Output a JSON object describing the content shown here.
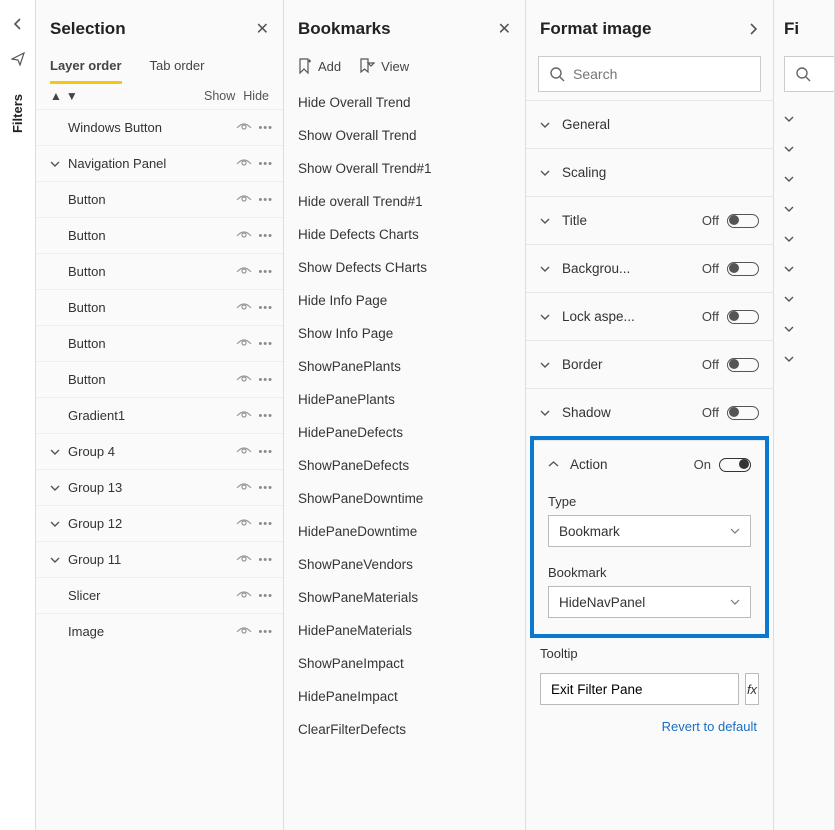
{
  "rail": {
    "filters_label": "Filters"
  },
  "selection": {
    "title": "Selection",
    "tabs": {
      "layer": "Layer order",
      "tab": "Tab order"
    },
    "show_label": "Show",
    "hide_label": "Hide",
    "items": [
      {
        "label": "Windows Button",
        "expandable": false
      },
      {
        "label": "Navigation Panel",
        "expandable": true
      },
      {
        "label": "Button",
        "expandable": false
      },
      {
        "label": "Button",
        "expandable": false
      },
      {
        "label": "Button",
        "expandable": false
      },
      {
        "label": "Button",
        "expandable": false
      },
      {
        "label": "Button",
        "expandable": false
      },
      {
        "label": "Button",
        "expandable": false
      },
      {
        "label": "Gradient1",
        "expandable": false
      },
      {
        "label": "Group 4",
        "expandable": true
      },
      {
        "label": "Group 13",
        "expandable": true
      },
      {
        "label": "Group 12",
        "expandable": true
      },
      {
        "label": "Group 11",
        "expandable": true
      },
      {
        "label": "Slicer",
        "expandable": false
      },
      {
        "label": "Image",
        "expandable": false
      }
    ]
  },
  "bookmarks": {
    "title": "Bookmarks",
    "add_label": "Add",
    "view_label": "View",
    "items": [
      "Hide Overall Trend",
      "Show Overall Trend",
      "Show Overall Trend#1",
      "Hide overall Trend#1",
      "Hide Defects Charts",
      "Show Defects CHarts",
      "Hide Info Page",
      "Show Info Page",
      "ShowPanePlants",
      "HidePanePlants",
      "HidePaneDefects",
      "ShowPaneDefects",
      "ShowPaneDowntime",
      "HidePaneDowntime",
      "ShowPaneVendors",
      "ShowPaneMaterials",
      "HidePaneMaterials",
      "ShowPaneImpact",
      "HidePaneImpact",
      "ClearFilterDefects"
    ]
  },
  "format": {
    "title": "Format image",
    "search_placeholder": "Search",
    "sections": [
      {
        "name": "General",
        "state": null,
        "expanded": false
      },
      {
        "name": "Scaling",
        "state": null,
        "expanded": false
      },
      {
        "name": "Title",
        "state": "Off",
        "expanded": false
      },
      {
        "name": "Backgrou...",
        "state": "Off",
        "expanded": false
      },
      {
        "name": "Lock aspe...",
        "state": "Off",
        "expanded": false
      },
      {
        "name": "Border",
        "state": "Off",
        "expanded": false
      },
      {
        "name": "Shadow",
        "state": "Off",
        "expanded": false
      }
    ],
    "action": {
      "name": "Action",
      "state": "On",
      "type_label": "Type",
      "type_value": "Bookmark",
      "bookmark_label": "Bookmark",
      "bookmark_value": "HideNavPanel"
    },
    "tooltip": {
      "label": "Tooltip",
      "value": "Exit Filter Pane",
      "fx": "fx"
    },
    "revert": "Revert to default"
  },
  "fields": {
    "title_fragment": "Fi",
    "rows_count": 9
  }
}
